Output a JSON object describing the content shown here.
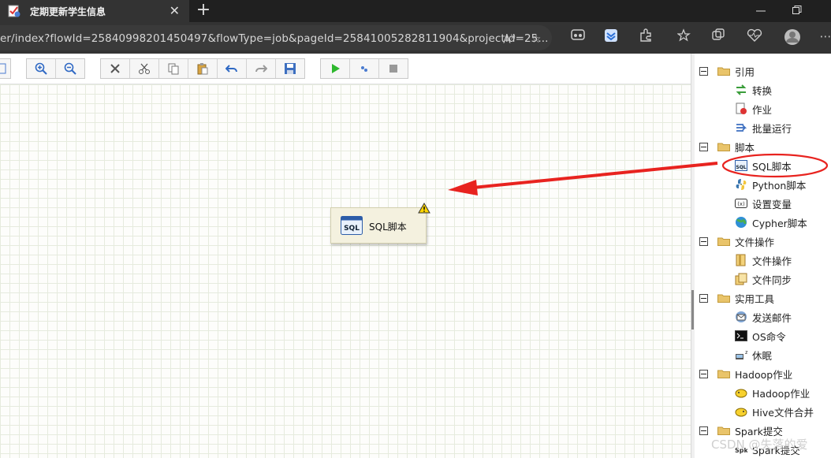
{
  "browser": {
    "tab_title": "定期更新学生信息",
    "url": "er/index?flowId=25840998201450497&flowType=job&pageId=25841005282811904&projectId=25...",
    "new_tab": "+",
    "close": "✕"
  },
  "canvas": {
    "node": {
      "label": "SQL脚本",
      "icon": "sql-script-icon",
      "warning": true
    }
  },
  "tree": {
    "groups": [
      {
        "label": "引用",
        "items": [
          {
            "label": "转换",
            "icon": "transform-icon"
          },
          {
            "label": "作业",
            "icon": "job-icon"
          },
          {
            "label": "批量运行",
            "icon": "batch-run-icon"
          }
        ]
      },
      {
        "label": "脚本",
        "items": [
          {
            "label": "SQL脚本",
            "icon": "sql-icon"
          },
          {
            "label": "Python脚本",
            "icon": "python-icon"
          },
          {
            "label": "设置变量",
            "icon": "variable-icon"
          },
          {
            "label": "Cypher脚本",
            "icon": "cypher-icon"
          }
        ]
      },
      {
        "label": "文件操作",
        "items": [
          {
            "label": "文件操作",
            "icon": "file-op-icon"
          },
          {
            "label": "文件同步",
            "icon": "file-sync-icon"
          }
        ]
      },
      {
        "label": "实用工具",
        "items": [
          {
            "label": "发送邮件",
            "icon": "mail-icon"
          },
          {
            "label": "OS命令",
            "icon": "terminal-icon"
          },
          {
            "label": "休眠",
            "icon": "sleep-icon"
          }
        ]
      },
      {
        "label": "Hadoop作业",
        "items": [
          {
            "label": "Hadoop作业",
            "icon": "hadoop-icon"
          },
          {
            "label": "Hive文件合并",
            "icon": "hive-icon"
          }
        ]
      },
      {
        "label": "Spark提交",
        "items": [
          {
            "label": "Spark提交",
            "icon": "spark-icon"
          }
        ]
      }
    ]
  },
  "watermark": "CSDN @失落的爱",
  "colors": {
    "annotation": "#e8231f",
    "folder": "#e9c46a",
    "accent": "#2a6fd6"
  }
}
